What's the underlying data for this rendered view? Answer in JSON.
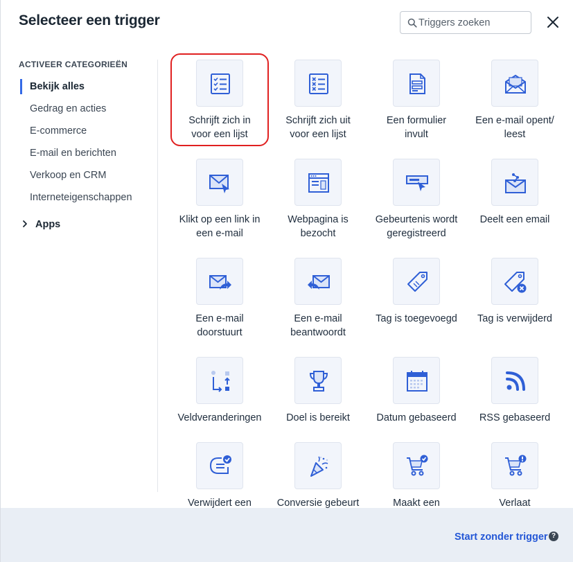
{
  "dialog": {
    "title": "Selecteer een trigger",
    "search_placeholder": "Triggers zoeken"
  },
  "sidebar": {
    "heading": "ACTIVEER CATEGORIEËN",
    "categories": [
      {
        "label": "Bekijk alles",
        "active": true
      },
      {
        "label": "Gedrag en acties",
        "active": false
      },
      {
        "label": "E-commerce",
        "active": false
      },
      {
        "label": "E-mail en berichten",
        "active": false
      },
      {
        "label": "Verkoop en CRM",
        "active": false
      },
      {
        "label": "Interneteigenschappen",
        "active": false
      }
    ],
    "apps_label": "Apps"
  },
  "triggers": [
    {
      "line1": "Schrijft zich in",
      "line2": "voor een lijst",
      "icon": "list-subscribe-icon",
      "highlighted": true
    },
    {
      "line1": "Schrijft zich uit",
      "line2": "voor een lijst",
      "icon": "list-unsubscribe-icon"
    },
    {
      "line1": "Een formulier",
      "line2": "invult",
      "icon": "form-icon"
    },
    {
      "line1": "Een e-mail opent/",
      "line2": "leest",
      "icon": "email-open-icon"
    },
    {
      "line1": "Klikt op een link in",
      "line2": "een e-mail",
      "icon": "email-click-icon"
    },
    {
      "line1": "Webpagina is",
      "line2": "bezocht",
      "icon": "webpage-icon"
    },
    {
      "line1": "Gebeurtenis wordt",
      "line2": "geregistreerd",
      "icon": "event-icon"
    },
    {
      "line1": "Deelt een email",
      "line2": "",
      "icon": "email-share-icon"
    },
    {
      "line1": "Een e-mail",
      "line2": "doorstuurt",
      "icon": "email-forward-icon"
    },
    {
      "line1": "Een e-mail",
      "line2": "beantwoordt",
      "icon": "email-reply-icon"
    },
    {
      "line1": "Tag is toegevoegd",
      "line2": "",
      "icon": "tag-added-icon"
    },
    {
      "line1": "Tag is verwijderd",
      "line2": "",
      "icon": "tag-removed-icon"
    },
    {
      "line1": "Veldveranderingen",
      "line2": "",
      "icon": "field-change-icon"
    },
    {
      "line1": "Doel is bereikt",
      "line2": "",
      "icon": "trophy-icon"
    },
    {
      "line1": "Datum gebaseerd",
      "line2": "",
      "icon": "calendar-icon"
    },
    {
      "line1": "RSS gebaseerd",
      "line2": "",
      "icon": "rss-icon"
    },
    {
      "line1": "Verwijdert een",
      "line2": "",
      "icon": "remove-chat-icon"
    },
    {
      "line1": "Conversie gebeurt",
      "line2": "",
      "icon": "party-icon"
    },
    {
      "line1": "Maakt een",
      "line2": "",
      "icon": "cart-check-icon"
    },
    {
      "line1": "Verlaat",
      "line2": "",
      "icon": "cart-alert-icon"
    }
  ],
  "footer": {
    "start_label": "Start zonder trigger",
    "help_glyph": "?"
  },
  "colors": {
    "accent": "#356ae6",
    "link": "#2457d6",
    "highlight": "#e02020",
    "icon_blue": "#2f5fd6",
    "footer_bg": "#e9eef5"
  }
}
